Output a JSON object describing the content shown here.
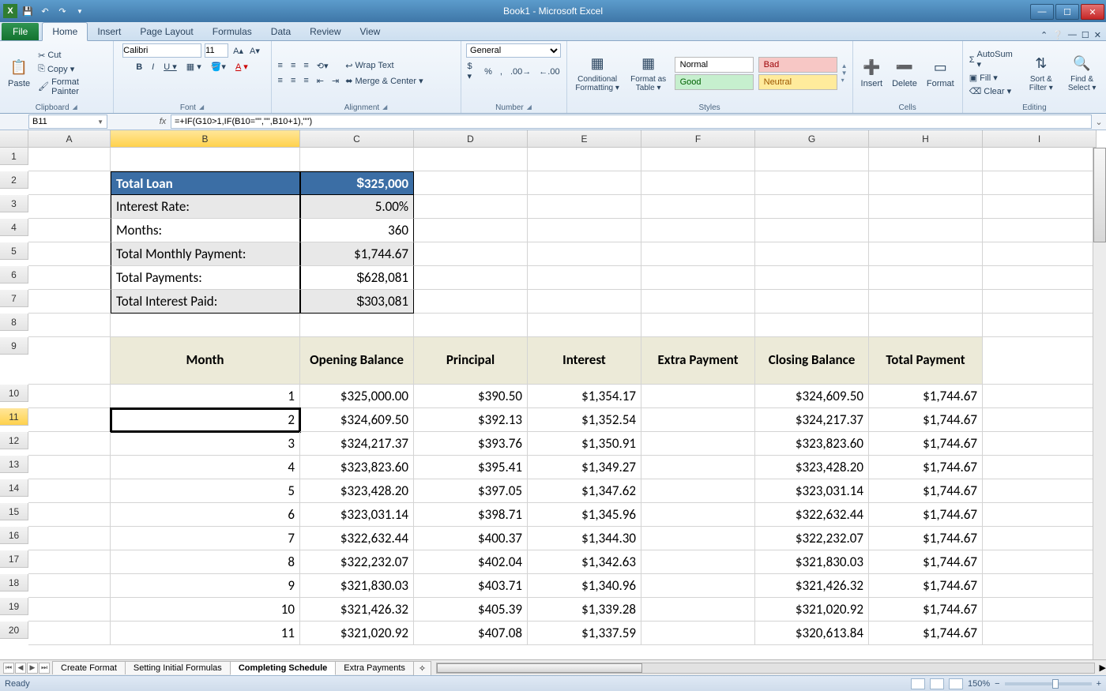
{
  "window": {
    "title": "Book1 - Microsoft Excel"
  },
  "tabs": {
    "file": "File",
    "home": "Home",
    "insert": "Insert",
    "pageLayout": "Page Layout",
    "formulas": "Formulas",
    "data": "Data",
    "review": "Review",
    "view": "View"
  },
  "ribbon": {
    "clipboard": {
      "label": "Clipboard",
      "paste": "Paste",
      "cut": "Cut",
      "copy": "Copy ▾",
      "painter": "Format Painter"
    },
    "font": {
      "label": "Font",
      "name": "Calibri",
      "size": "11"
    },
    "alignment": {
      "label": "Alignment",
      "wrap": "Wrap Text",
      "merge": "Merge & Center ▾"
    },
    "number": {
      "label": "Number",
      "format": "General"
    },
    "styles": {
      "label": "Styles",
      "cond": "Conditional Formatting ▾",
      "fat": "Format as Table ▾",
      "normal": "Normal",
      "bad": "Bad",
      "good": "Good",
      "neutral": "Neutral"
    },
    "cells": {
      "label": "Cells",
      "insert": "Insert",
      "delete": "Delete",
      "format": "Format"
    },
    "editing": {
      "label": "Editing",
      "autosum": "AutoSum ▾",
      "fill": "Fill ▾",
      "clear": "Clear ▾",
      "sort": "Sort & Filter ▾",
      "find": "Find & Select ▾"
    }
  },
  "namebox": "B11",
  "formula": "=+IF(G10>1,IF(B10=\"\",\"\",B10+1),\"\")",
  "columns": [
    "A",
    "B",
    "C",
    "D",
    "E",
    "F",
    "G",
    "H",
    "I"
  ],
  "summary": {
    "loan_label": "Total Loan",
    "loan_sym": "$",
    "loan_val": "325,000",
    "rate_label": "Interest Rate:",
    "rate_val": "5.00%",
    "months_label": "Months:",
    "months_val": "360",
    "pmt_label": "Total Monthly  Payment:",
    "pmt_val": "$1,744.67",
    "totpay_label": "Total Payments:",
    "totpay_sym": "$",
    "totpay_val": "628,081",
    "totint_label": "Total Interest Paid:",
    "totint_sym": "$",
    "totint_val": "303,081"
  },
  "table_headers": {
    "month": "Month",
    "open": "Opening Balance",
    "prin": "Principal",
    "int": "Interest",
    "extra": "Extra Payment",
    "close": "Closing Balance",
    "tot": "Total Payment"
  },
  "rows": [
    {
      "n": "1",
      "m": "1",
      "open": "$325,000.00",
      "prin": "$390.50",
      "int": "$1,354.17",
      "extra": "",
      "close": "$324,609.50",
      "tot": "$1,744.67"
    },
    {
      "n": "2",
      "m": "2",
      "open": "$324,609.50",
      "prin": "$392.13",
      "int": "$1,352.54",
      "extra": "",
      "close": "$324,217.37",
      "tot": "$1,744.67"
    },
    {
      "n": "3",
      "m": "3",
      "open": "$324,217.37",
      "prin": "$393.76",
      "int": "$1,350.91",
      "extra": "",
      "close": "$323,823.60",
      "tot": "$1,744.67"
    },
    {
      "n": "4",
      "m": "4",
      "open": "$323,823.60",
      "prin": "$395.41",
      "int": "$1,349.27",
      "extra": "",
      "close": "$323,428.20",
      "tot": "$1,744.67"
    },
    {
      "n": "5",
      "m": "5",
      "open": "$323,428.20",
      "prin": "$397.05",
      "int": "$1,347.62",
      "extra": "",
      "close": "$323,031.14",
      "tot": "$1,744.67"
    },
    {
      "n": "6",
      "m": "6",
      "open": "$323,031.14",
      "prin": "$398.71",
      "int": "$1,345.96",
      "extra": "",
      "close": "$322,632.44",
      "tot": "$1,744.67"
    },
    {
      "n": "7",
      "m": "7",
      "open": "$322,632.44",
      "prin": "$400.37",
      "int": "$1,344.30",
      "extra": "",
      "close": "$322,232.07",
      "tot": "$1,744.67"
    },
    {
      "n": "8",
      "m": "8",
      "open": "$322,232.07",
      "prin": "$402.04",
      "int": "$1,342.63",
      "extra": "",
      "close": "$321,830.03",
      "tot": "$1,744.67"
    },
    {
      "n": "9",
      "m": "9",
      "open": "$321,830.03",
      "prin": "$403.71",
      "int": "$1,340.96",
      "extra": "",
      "close": "$321,426.32",
      "tot": "$1,744.67"
    },
    {
      "n": "10",
      "m": "10",
      "open": "$321,426.32",
      "prin": "$405.39",
      "int": "$1,339.28",
      "extra": "",
      "close": "$321,020.92",
      "tot": "$1,744.67"
    },
    {
      "n": "11",
      "m": "11",
      "open": "$321,020.92",
      "prin": "$407.08",
      "int": "$1,337.59",
      "extra": "",
      "close": "$320,613.84",
      "tot": "$1,744.67"
    }
  ],
  "sheets": {
    "s1": "Create Format",
    "s2": "Setting Initial Formulas",
    "s3": "Completing Schedule",
    "s4": "Extra Payments"
  },
  "status": {
    "ready": "Ready",
    "zoom": "150%"
  }
}
